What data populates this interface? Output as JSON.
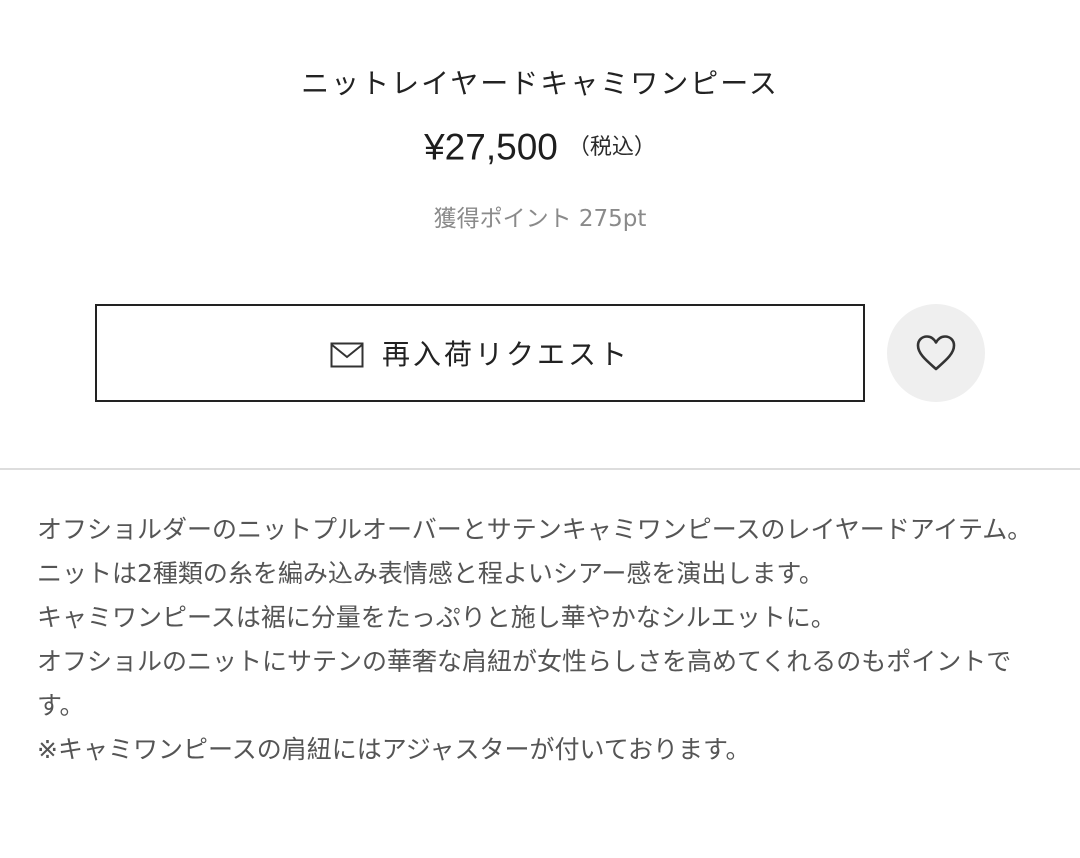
{
  "product": {
    "title": "ニットレイヤードキャミワンピース",
    "price": "¥27,500",
    "tax_note": "（税込）",
    "points": "獲得ポイント 275pt"
  },
  "actions": {
    "restock_request_label": "再入荷リクエスト",
    "restock_icon": "mail-icon",
    "favorite_icon": "heart-icon"
  },
  "description": {
    "lines": [
      "オフショルダーのニットプルオーバーとサテンキャミワンピースのレイヤードアイテム。",
      "ニットは2種類の糸を編み込み表情感と程よいシアー感を演出します。",
      "キャミワンピースは裾に分量をたっぷりと施し華やかなシルエットに。",
      "オフショルのニットにサテンの華奢な肩紐が女性らしさを高めてくれるのもポイントです。",
      "※キャミワンピースの肩紐にはアジャスターが付いております。"
    ]
  },
  "colors": {
    "text_primary": "#222222",
    "text_muted": "#8a8a8a",
    "button_border": "#222222",
    "favorite_bg": "#efefef",
    "divider": "#dddddd"
  }
}
